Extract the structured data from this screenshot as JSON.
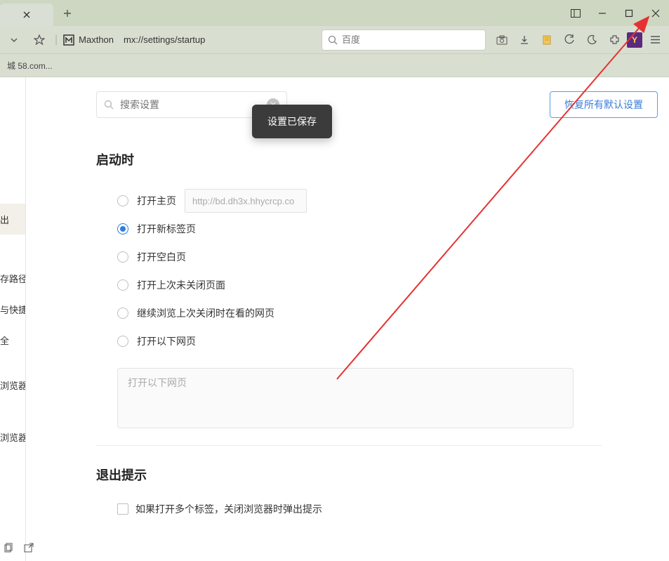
{
  "titlebar": {
    "newtab_tip": "+"
  },
  "toolbar": {
    "brand": "Maxthon",
    "url": "mx://settings/startup",
    "search_placeholder": "百度",
    "y_label": "Y"
  },
  "bookmarks": {
    "item0": "城 58.com..."
  },
  "sidebar": {
    "items": [
      "",
      "",
      "",
      "",
      "出",
      "",
      "存路径",
      "与快捷键",
      "全",
      "",
      "浏览器",
      "",
      "浏览器"
    ]
  },
  "settings": {
    "search_placeholder": "搜索设置",
    "restore_defaults": "恢复所有默认设置",
    "toast": "设置已保存",
    "section_startup": "启动时",
    "opt_home": "打开主页",
    "home_url": "http://bd.dh3x.hhycrcp.co",
    "opt_newtab": "打开新标签页",
    "opt_blank": "打开空白页",
    "opt_last": "打开上次未关闭页面",
    "opt_continue": "继续浏览上次关闭时在看的网页",
    "opt_urls": "打开以下网页",
    "url_placeholder": "打开以下网页",
    "section_exit": "退出提示",
    "exit_chk": "如果打开多个标签，关闭浏览器时弹出提示"
  }
}
